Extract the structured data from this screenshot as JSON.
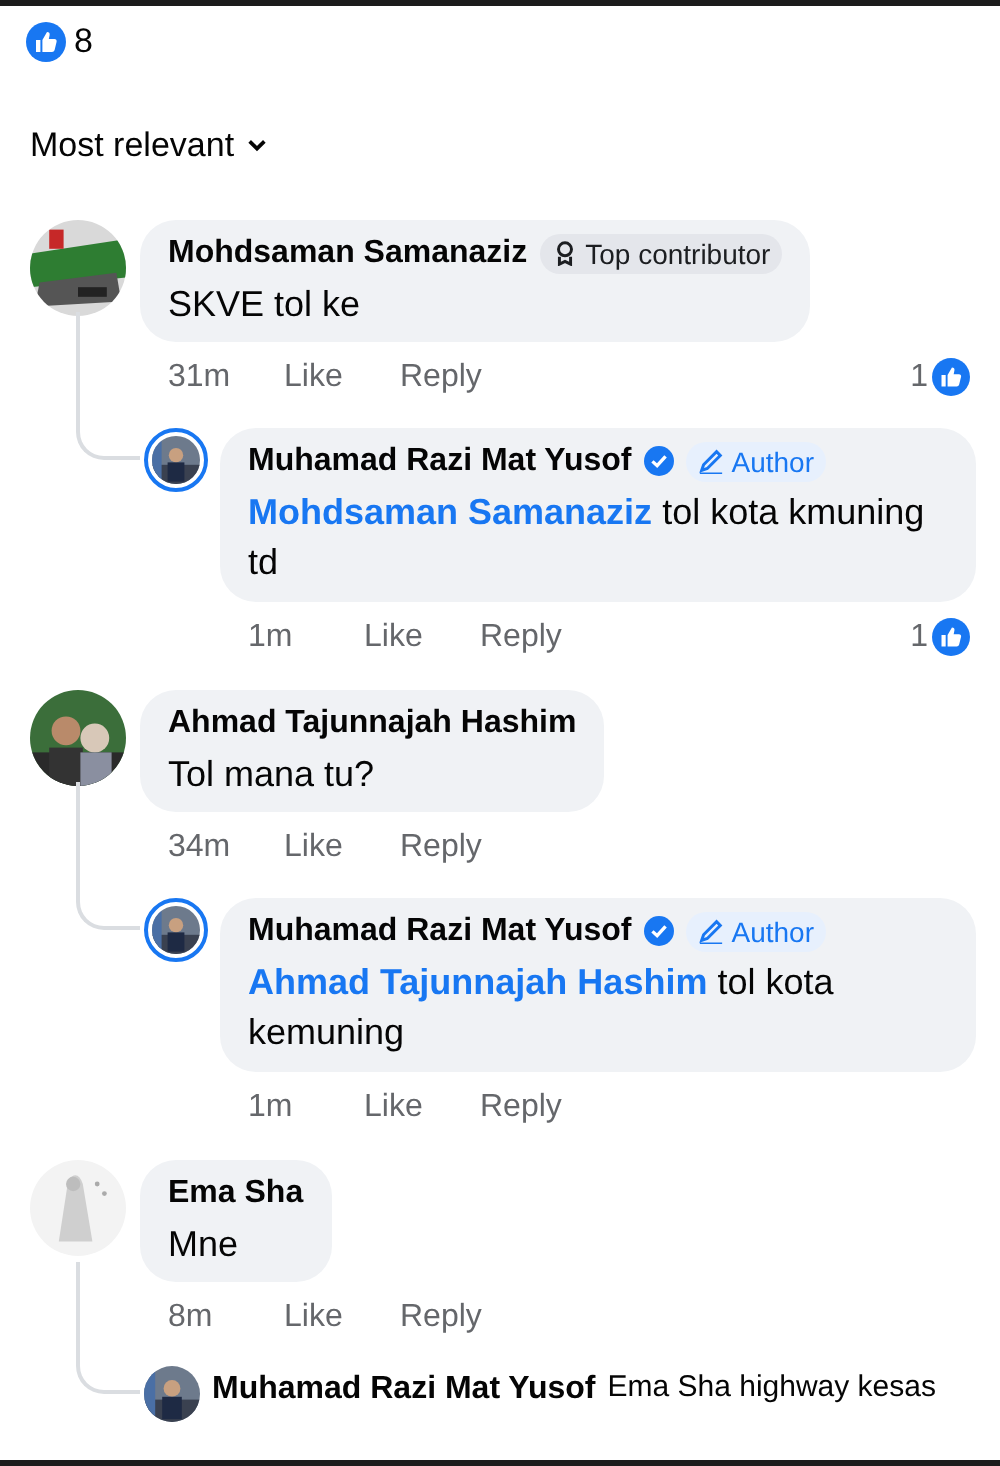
{
  "reactions": {
    "count": "8"
  },
  "sort": {
    "label": "Most relevant"
  },
  "comments": [
    {
      "author": "Mohdsaman Samanaziz",
      "badge": {
        "kind": "top_contributor",
        "label": "Top contributor"
      },
      "verified": false,
      "text": "SKVE tol ke",
      "time": "31m",
      "like": "Like",
      "reply": "Reply",
      "likes": "1",
      "replies": [
        {
          "kind": "bubble",
          "author": "Muhamad Razi Mat Yusof",
          "verified": true,
          "badge": {
            "kind": "author",
            "label": "Author"
          },
          "avatar_ring": true,
          "mention": "Mohdsaman Samanaziz",
          "text": "tol kota kmuning td",
          "time": "1m",
          "like": "Like",
          "reply": "Reply",
          "likes": "1"
        }
      ]
    },
    {
      "author": "Ahmad Tajunnajah Hashim",
      "verified": false,
      "text": "Tol mana tu?",
      "time": "34m",
      "like": "Like",
      "reply": "Reply",
      "replies": [
        {
          "kind": "bubble",
          "author": "Muhamad Razi Mat Yusof",
          "verified": true,
          "badge": {
            "kind": "author",
            "label": "Author"
          },
          "avatar_ring": true,
          "mention": "Ahmad Tajunnajah Hashim",
          "text": "tol kota kemuning",
          "time": "1m",
          "like": "Like",
          "reply": "Reply"
        }
      ]
    },
    {
      "author": "Ema Sha",
      "verified": false,
      "text": "Mne",
      "time": "8m",
      "like": "Like",
      "reply": "Reply",
      "replies": [
        {
          "kind": "inline",
          "author": "Muhamad Razi Mat Yusof",
          "avatar_ring": false,
          "text": "Ema Sha highway kesas"
        }
      ]
    }
  ]
}
